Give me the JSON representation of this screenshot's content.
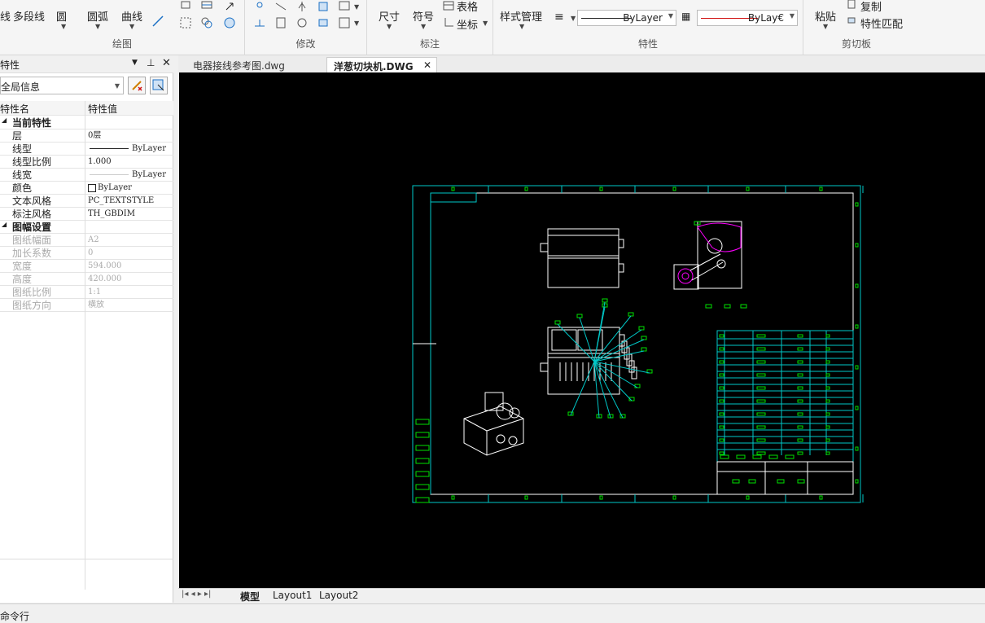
{
  "ribbon": {
    "draw": {
      "label": "绘图",
      "line_partial": "线",
      "polyline": "多段线",
      "circle": "圆",
      "arc": "圆弧",
      "curve": "曲线"
    },
    "modify": {
      "label": "修改"
    },
    "annotate": {
      "label": "标注",
      "dimension": "尺寸",
      "symbol": "符号",
      "table": "表格",
      "coordinate": "坐标"
    },
    "properties": {
      "label": "特性",
      "style_manager": "样式管理",
      "linetype_value": "ByLayer",
      "color_value": "ByLay€"
    },
    "clipboard": {
      "label": "剪切板",
      "paste": "粘贴",
      "copy": "复制",
      "match_properties": "特性匹配"
    }
  },
  "properties_panel": {
    "title": "特性",
    "selector": "全局信息",
    "col_name": "特性名",
    "col_value": "特性值",
    "sections": [
      {
        "title": "当前特性",
        "rows": [
          {
            "k": "层",
            "v": "0层"
          },
          {
            "k": "线型",
            "v": "ByLayer"
          },
          {
            "k": "线型比例",
            "v": "1.000"
          },
          {
            "k": "线宽",
            "v": "ByLayer"
          },
          {
            "k": "颜色",
            "v": "ByLayer"
          },
          {
            "k": "文本风格",
            "v": "PC_TEXTSTYLE"
          },
          {
            "k": "标注风格",
            "v": "TH_GBDIM"
          }
        ]
      },
      {
        "title": "图幅设置",
        "rows": [
          {
            "k": "图纸幅面",
            "v": "A2"
          },
          {
            "k": "加长系数",
            "v": "0"
          },
          {
            "k": "宽度",
            "v": "594.000"
          },
          {
            "k": "高度",
            "v": "420.000"
          },
          {
            "k": "图纸比例",
            "v": "1:1"
          },
          {
            "k": "图纸方向",
            "v": "横放"
          }
        ]
      }
    ]
  },
  "doc_tabs": [
    {
      "label": "电器接线参考图.dwg",
      "active": false
    },
    {
      "label": "洋葱切块机.DWG",
      "active": true
    }
  ],
  "layout_tabs": [
    "模型",
    "Layout1",
    "Layout2"
  ],
  "command_line": "命令行",
  "colors": {
    "canvas": "#000000",
    "frame": "#00c8c8",
    "green": "#00e000",
    "magenta": "#ff00ff",
    "white": "#ffffff",
    "linetype_red": "#d01010"
  }
}
